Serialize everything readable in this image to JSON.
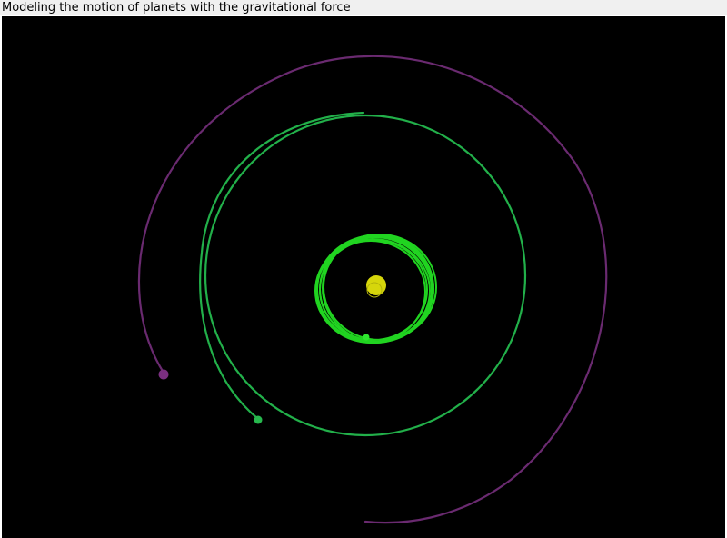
{
  "window": {
    "title": "Modeling the motion of planets with the gravitational force"
  },
  "scene": {
    "background_color": "#000000",
    "sun": {
      "name": "sun",
      "color": "#d6d60b"
    },
    "planets": [
      {
        "name": "inner-planet",
        "color": "#2ee62e",
        "trail_color": "#21d421"
      },
      {
        "name": "middle-planet",
        "color": "#27b84e",
        "trail_color": "#22b04a"
      },
      {
        "name": "outer-planet",
        "color": "#7a2f80",
        "trail_color": "#6a2a70"
      }
    ]
  }
}
